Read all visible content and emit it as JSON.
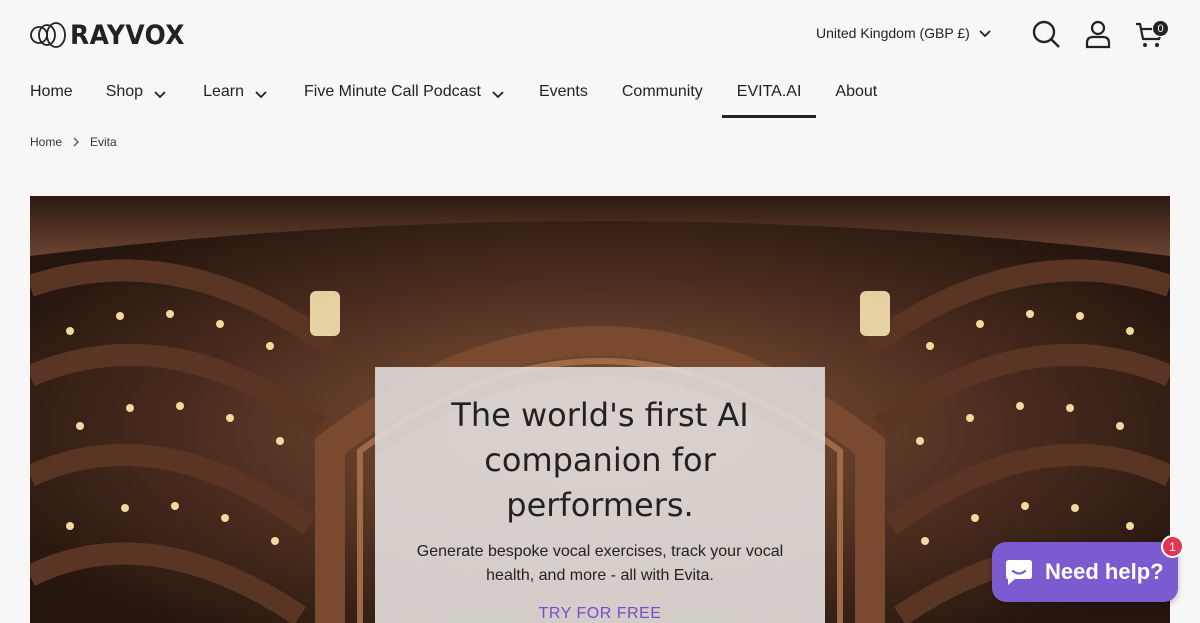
{
  "brand": {
    "name": "RAYVOX",
    "logo_icon": "rings-logo-icon"
  },
  "header": {
    "currency_label": "United Kingdom (GBP £)",
    "icons": [
      "search-icon",
      "account-icon",
      "cart-icon"
    ],
    "cart_count": "0"
  },
  "nav": [
    {
      "label": "Home",
      "dropdown": false
    },
    {
      "label": "Shop",
      "dropdown": true
    },
    {
      "label": "Learn",
      "dropdown": true
    },
    {
      "label": "Five Minute Call Podcast",
      "dropdown": true
    },
    {
      "label": "Events",
      "dropdown": false
    },
    {
      "label": "Community",
      "dropdown": false
    },
    {
      "label": "EVITA.AI",
      "dropdown": false,
      "active": true
    },
    {
      "label": "About",
      "dropdown": false
    }
  ],
  "breadcrumb": {
    "home": "Home",
    "current": "Evita"
  },
  "hero": {
    "title": "The world's first AI companion for performers.",
    "subtitle": "Generate bespoke vocal exercises, track your vocal health, and more - all with Evita.",
    "cta": "TRY FOR FREE"
  },
  "chat": {
    "label": "Need help?",
    "badge": "1",
    "icon": "chat-bubble-icon"
  },
  "colors": {
    "accent": "#7b5bd0",
    "cta": "#7b4ac9",
    "badge": "#e0364f",
    "text": "#222222",
    "background": "#f7f7f7"
  }
}
